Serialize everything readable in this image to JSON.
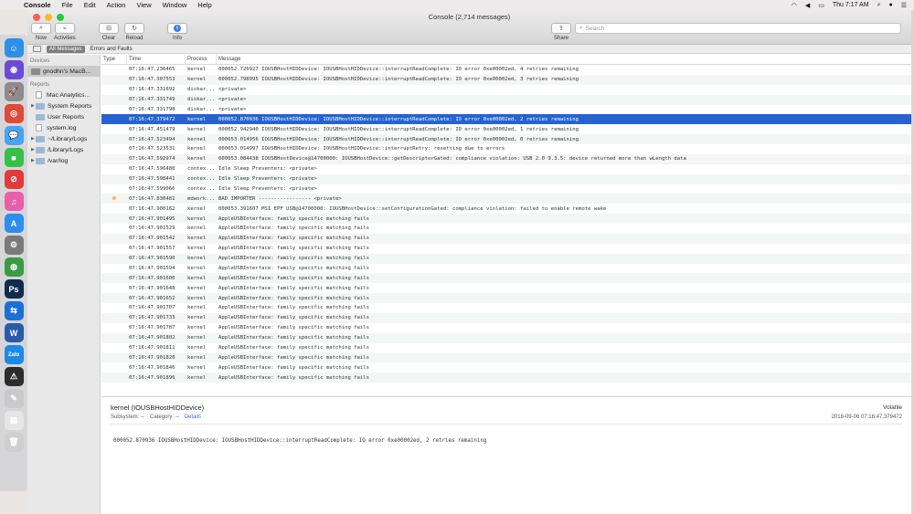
{
  "menubar": {
    "app": "Console",
    "items": [
      "File",
      "Edit",
      "Action",
      "View",
      "Window",
      "Help"
    ],
    "clock": "Thu 7:17 AM"
  },
  "window": {
    "title": "Console (2,714 messages)"
  },
  "toolbar": {
    "now": "Now",
    "activities": "Activities",
    "clear": "Clear",
    "reload": "Reload",
    "info": "Info",
    "share": "Share",
    "search_placeholder": "Search"
  },
  "filters": {
    "all": "All Messages",
    "errors": "Errors and Faults"
  },
  "sidebar": {
    "devices_header": "Devices",
    "device": "gnodhn's MacB...",
    "reports_header": "Reports",
    "items": [
      {
        "label": "Mac Analytics...",
        "icon": "doc",
        "disclosure": false
      },
      {
        "label": "System Reports",
        "icon": "folder",
        "disclosure": true
      },
      {
        "label": "User Reports",
        "icon": "folder",
        "disclosure": false
      },
      {
        "label": "system.log",
        "icon": "doc",
        "disclosure": false
      },
      {
        "label": "~/Library/Logs",
        "icon": "folder",
        "disclosure": true
      },
      {
        "label": "/Library/Logs",
        "icon": "folder",
        "disclosure": true
      },
      {
        "label": "/var/log",
        "icon": "folder",
        "disclosure": true
      }
    ]
  },
  "columns": {
    "type": "Type",
    "time": "Time",
    "process": "Process",
    "message": "Message"
  },
  "rows": [
    {
      "time": "07:16:47.236465",
      "proc": "kernel",
      "msg": "000052.726927 IOUSBHostHIDDevice: IOUSBHostHIDDevice::interruptReadComplete: IO error 0xe00002ed, 4 retries remaining"
    },
    {
      "time": "07:16:47.307553",
      "proc": "kernel",
      "msg": "000052.798995 IOUSBHostHIDDevice: IOUSBHostHIDDevice::interruptReadComplete: IO error 0xe00002ed, 3 retries remaining"
    },
    {
      "time": "07:16:47.331692",
      "proc": "diskar...",
      "msg": "<private>"
    },
    {
      "time": "07:16:47.331749",
      "proc": "diskar...",
      "msg": "<private>"
    },
    {
      "time": "07:16:47.331798",
      "proc": "diskar...",
      "msg": "<private>"
    },
    {
      "time": "07:16:47.379472",
      "proc": "kernel",
      "msg": "000052.870936 IOUSBHostHIDDevice: IOUSBHostHIDDevice::interruptReadComplete: IO error 0xe00002ed, 2 retries remaining",
      "selected": true
    },
    {
      "time": "07:16:47.451479",
      "proc": "kernel",
      "msg": "000052.942940 IOUSBHostHIDDevice: IOUSBHostHIDDevice::interruptReadComplete: IO error 0xe00002ed, 1 retries remaining"
    },
    {
      "time": "07:16:47.523494",
      "proc": "kernel",
      "msg": "000053.014956 IOUSBHostHIDDevice: IOUSBHostHIDDevice::interruptReadComplete: IO error 0xe00002ed, 0 retries remaining"
    },
    {
      "time": "07:16:47.523531",
      "proc": "kernel",
      "msg": "000053.014997 IOUSBHostHIDDevice: IOUSBHostHIDDevice::interruptRetry: resetting due to errors"
    },
    {
      "time": "07:16:47.592974",
      "proc": "kernel",
      "msg": "000053.084438 IOUSBHostDevice@14700000: IOUSBHostDevice::getDescriptorGated: compliance violation: USB 2.0 9.3.5: device returned more than wLength data"
    },
    {
      "time": "07:16:47.596480",
      "proc": "contex...",
      "msg": "Idle Sleep Preventers: <private>"
    },
    {
      "time": "07:16:47.598441",
      "proc": "contex...",
      "msg": "Idle Sleep Preventers: <private>"
    },
    {
      "time": "07:16:47.599066",
      "proc": "contex...",
      "msg": "Idle Sleep Preventers: <private>"
    },
    {
      "time": "07:16:47.830481",
      "proc": "mdwork...",
      "msg": "BAD IMPORTER ----------------- <private>",
      "dot": true
    },
    {
      "time": "07:16:47.900162",
      "proc": "kernel",
      "msg": "000053.391607 MSI EPF USB@14700000: IOUSBHostDevice::setConfigurationGated: compliance violation: failed to enable remote wake"
    },
    {
      "time": "07:16:47.901495",
      "proc": "kernel",
      "msg": "AppleUSBInterface: family specific matching fails"
    },
    {
      "time": "07:16:47.901529",
      "proc": "kernel",
      "msg": "AppleUSBInterface: family specific matching fails"
    },
    {
      "time": "07:16:47.901542",
      "proc": "kernel",
      "msg": "AppleUSBInterface: family specific matching fails"
    },
    {
      "time": "07:16:47.901557",
      "proc": "kernel",
      "msg": "AppleUSBInterface: family specific matching fails"
    },
    {
      "time": "07:16:47.901590",
      "proc": "kernel",
      "msg": "AppleUSBInterface: family specific matching fails"
    },
    {
      "time": "07:16:47.901594",
      "proc": "kernel",
      "msg": "AppleUSBInterface: family specific matching fails"
    },
    {
      "time": "07:16:47.901600",
      "proc": "kernel",
      "msg": "AppleUSBInterface: family specific matching fails"
    },
    {
      "time": "07:16:47.901648",
      "proc": "kernel",
      "msg": "AppleUSBInterface: family specific matching fails"
    },
    {
      "time": "07:16:47.901652",
      "proc": "kernel",
      "msg": "AppleUSBInterface: family specific matching fails"
    },
    {
      "time": "07:16:47.901707",
      "proc": "kernel",
      "msg": "AppleUSBInterface: family specific matching fails"
    },
    {
      "time": "07:16:47.901733",
      "proc": "kernel",
      "msg": "AppleUSBInterface: family specific matching fails"
    },
    {
      "time": "07:16:47.901787",
      "proc": "kernel",
      "msg": "AppleUSBInterface: family specific matching fails"
    },
    {
      "time": "07:16:47.901802",
      "proc": "kernel",
      "msg": "AppleUSBInterface: family specific matching fails"
    },
    {
      "time": "07:16:47.901811",
      "proc": "kernel",
      "msg": "AppleUSBInterface: family specific matching fails"
    },
    {
      "time": "07:16:47.901820",
      "proc": "kernel",
      "msg": "AppleUSBInterface: family specific matching fails"
    },
    {
      "time": "07:16:47.901846",
      "proc": "kernel",
      "msg": "AppleUSBInterface: family specific matching fails"
    },
    {
      "time": "07:16:47.901896",
      "proc": "kernel",
      "msg": "AppleUSBInterface: family specific matching fails"
    }
  ],
  "detail": {
    "title": "kernel (IOUSBHostHIDDevice)",
    "volatility": "Volatile",
    "subsystem_label": "Subsystem:",
    "subsystem_value": "--",
    "category_label": "Category:",
    "category_value": "--",
    "details_link": "Details",
    "date": "2018-09-06 07:16:47.379472",
    "message": "000052.870936 IOUSBHostHIDDevice: IOUSBHostHIDDevice::interruptReadComplete: IO error 0xe00002ed, 2 retries remaining"
  },
  "dock": [
    {
      "name": "finder-icon",
      "color": "#2f8fe6",
      "glyph": "☺"
    },
    {
      "name": "siri-icon",
      "color": "#6a4bd6",
      "glyph": "◉"
    },
    {
      "name": "launchpad-icon",
      "color": "#8c8c8c",
      "glyph": "🚀"
    },
    {
      "name": "chrome-icon",
      "color": "#dd4b39",
      "glyph": "◎"
    },
    {
      "name": "messages-icon",
      "color": "#4aa3f0",
      "glyph": "💬"
    },
    {
      "name": "facetime-icon",
      "color": "#35c04a",
      "glyph": "■"
    },
    {
      "name": "blocked-icon",
      "color": "#e23b3b",
      "glyph": "⊘"
    },
    {
      "name": "itunes-icon",
      "color": "#e85fa9",
      "glyph": "♫"
    },
    {
      "name": "app-store-icon",
      "color": "#2d8ef0",
      "glyph": "A"
    },
    {
      "name": "system-prefs-icon",
      "color": "#7a7a7a",
      "glyph": "⚙"
    },
    {
      "name": "globe-icon",
      "color": "#3b9b45",
      "glyph": "◍"
    },
    {
      "name": "photoshop-icon",
      "color": "#0f2c4c",
      "glyph": "Ps"
    },
    {
      "name": "teamviewer-icon",
      "color": "#1c6fd6",
      "glyph": "⇆"
    },
    {
      "name": "word-icon",
      "color": "#2b5ba8",
      "glyph": "W"
    },
    {
      "name": "zalo-icon",
      "color": "#1e88e5",
      "glyph": "Zalo"
    },
    {
      "name": "console-icon",
      "color": "#2d2d2d",
      "glyph": "⚠"
    },
    {
      "name": "notes-icon",
      "color": "#c9c9c9",
      "glyph": "✎"
    },
    {
      "name": "document-icon",
      "color": "#e6e6e6",
      "glyph": "▤"
    },
    {
      "name": "trash-icon",
      "color": "#cfcfcf",
      "glyph": "🗑"
    }
  ]
}
